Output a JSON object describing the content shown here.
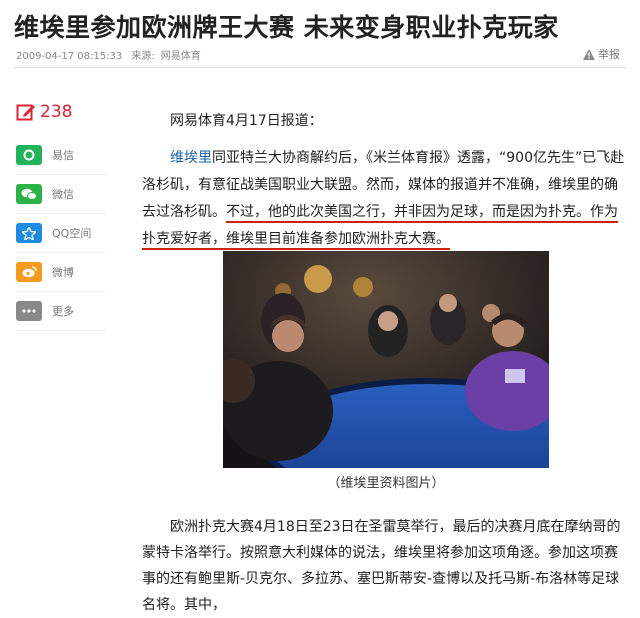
{
  "title": "维埃里参加欧洲牌王大赛 未来变身职业扑克玩家",
  "meta": {
    "datetime": "2009-04-17 08:15:33",
    "source_label": "来源:",
    "source": "网易体育"
  },
  "report_label": "举报",
  "comment_count": "238",
  "share": [
    {
      "label": "易信",
      "color": "#21b35a",
      "icon": "yixin-icon"
    },
    {
      "label": "微信",
      "color": "#2bb34a",
      "icon": "wechat-icon"
    },
    {
      "label": "QQ空间",
      "color": "#1e8be0",
      "icon": "qzone-icon"
    },
    {
      "label": "微博",
      "color": "#f39a1f",
      "icon": "weibo-icon"
    },
    {
      "label": "更多",
      "color": "#888888",
      "icon": "more-icon"
    }
  ],
  "article": {
    "intro": "网易体育4月17日报道：",
    "p2_link": "维埃里",
    "p2_a": "同亚特兰大协商解约后，《米兰体育报》透露，“900亿先生”已飞赴洛杉矶，有意征战美国职业大联盟。然而，媒体的报道并不准确，维埃里的确去过洛杉矶。",
    "p2_underlined": "不过，他的此次美国之行，并非因为足球，而是因为扑克。作为扑克爱好者，维埃里目前准备参加欧洲扑克大赛。",
    "caption": "（维埃里资料图片）",
    "p3": "欧洲扑克大赛4月18日至23日在圣雷莫举行，最后的决赛月底在摩纳哥的蒙特卡洛举行。按照意大利媒体的说法，维埃里将参加这项角逐。参加这项赛事的还有鲍里斯-贝克尔、多拉苏、塞巴斯蒂安-查博以及托马斯-布洛林等足球名将。其中，"
  },
  "colors": {
    "accent_red": "#c21f1f",
    "link_blue": "#1a5fa8"
  }
}
